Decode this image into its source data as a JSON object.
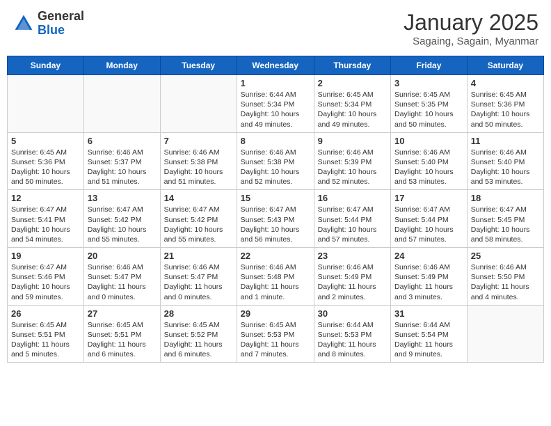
{
  "header": {
    "logo_general": "General",
    "logo_blue": "Blue",
    "month_title": "January 2025",
    "subtitle": "Sagaing, Sagain, Myanmar"
  },
  "days_of_week": [
    "Sunday",
    "Monday",
    "Tuesday",
    "Wednesday",
    "Thursday",
    "Friday",
    "Saturday"
  ],
  "weeks": [
    [
      {
        "num": "",
        "info": ""
      },
      {
        "num": "",
        "info": ""
      },
      {
        "num": "",
        "info": ""
      },
      {
        "num": "1",
        "info": "Sunrise: 6:44 AM\nSunset: 5:34 PM\nDaylight: 10 hours\nand 49 minutes."
      },
      {
        "num": "2",
        "info": "Sunrise: 6:45 AM\nSunset: 5:34 PM\nDaylight: 10 hours\nand 49 minutes."
      },
      {
        "num": "3",
        "info": "Sunrise: 6:45 AM\nSunset: 5:35 PM\nDaylight: 10 hours\nand 50 minutes."
      },
      {
        "num": "4",
        "info": "Sunrise: 6:45 AM\nSunset: 5:36 PM\nDaylight: 10 hours\nand 50 minutes."
      }
    ],
    [
      {
        "num": "5",
        "info": "Sunrise: 6:45 AM\nSunset: 5:36 PM\nDaylight: 10 hours\nand 50 minutes."
      },
      {
        "num": "6",
        "info": "Sunrise: 6:46 AM\nSunset: 5:37 PM\nDaylight: 10 hours\nand 51 minutes."
      },
      {
        "num": "7",
        "info": "Sunrise: 6:46 AM\nSunset: 5:38 PM\nDaylight: 10 hours\nand 51 minutes."
      },
      {
        "num": "8",
        "info": "Sunrise: 6:46 AM\nSunset: 5:38 PM\nDaylight: 10 hours\nand 52 minutes."
      },
      {
        "num": "9",
        "info": "Sunrise: 6:46 AM\nSunset: 5:39 PM\nDaylight: 10 hours\nand 52 minutes."
      },
      {
        "num": "10",
        "info": "Sunrise: 6:46 AM\nSunset: 5:40 PM\nDaylight: 10 hours\nand 53 minutes."
      },
      {
        "num": "11",
        "info": "Sunrise: 6:46 AM\nSunset: 5:40 PM\nDaylight: 10 hours\nand 53 minutes."
      }
    ],
    [
      {
        "num": "12",
        "info": "Sunrise: 6:47 AM\nSunset: 5:41 PM\nDaylight: 10 hours\nand 54 minutes."
      },
      {
        "num": "13",
        "info": "Sunrise: 6:47 AM\nSunset: 5:42 PM\nDaylight: 10 hours\nand 55 minutes."
      },
      {
        "num": "14",
        "info": "Sunrise: 6:47 AM\nSunset: 5:42 PM\nDaylight: 10 hours\nand 55 minutes."
      },
      {
        "num": "15",
        "info": "Sunrise: 6:47 AM\nSunset: 5:43 PM\nDaylight: 10 hours\nand 56 minutes."
      },
      {
        "num": "16",
        "info": "Sunrise: 6:47 AM\nSunset: 5:44 PM\nDaylight: 10 hours\nand 57 minutes."
      },
      {
        "num": "17",
        "info": "Sunrise: 6:47 AM\nSunset: 5:44 PM\nDaylight: 10 hours\nand 57 minutes."
      },
      {
        "num": "18",
        "info": "Sunrise: 6:47 AM\nSunset: 5:45 PM\nDaylight: 10 hours\nand 58 minutes."
      }
    ],
    [
      {
        "num": "19",
        "info": "Sunrise: 6:47 AM\nSunset: 5:46 PM\nDaylight: 10 hours\nand 59 minutes."
      },
      {
        "num": "20",
        "info": "Sunrise: 6:46 AM\nSunset: 5:47 PM\nDaylight: 11 hours\nand 0 minutes."
      },
      {
        "num": "21",
        "info": "Sunrise: 6:46 AM\nSunset: 5:47 PM\nDaylight: 11 hours\nand 0 minutes."
      },
      {
        "num": "22",
        "info": "Sunrise: 6:46 AM\nSunset: 5:48 PM\nDaylight: 11 hours\nand 1 minute."
      },
      {
        "num": "23",
        "info": "Sunrise: 6:46 AM\nSunset: 5:49 PM\nDaylight: 11 hours\nand 2 minutes."
      },
      {
        "num": "24",
        "info": "Sunrise: 6:46 AM\nSunset: 5:49 PM\nDaylight: 11 hours\nand 3 minutes."
      },
      {
        "num": "25",
        "info": "Sunrise: 6:46 AM\nSunset: 5:50 PM\nDaylight: 11 hours\nand 4 minutes."
      }
    ],
    [
      {
        "num": "26",
        "info": "Sunrise: 6:45 AM\nSunset: 5:51 PM\nDaylight: 11 hours\nand 5 minutes."
      },
      {
        "num": "27",
        "info": "Sunrise: 6:45 AM\nSunset: 5:51 PM\nDaylight: 11 hours\nand 6 minutes."
      },
      {
        "num": "28",
        "info": "Sunrise: 6:45 AM\nSunset: 5:52 PM\nDaylight: 11 hours\nand 6 minutes."
      },
      {
        "num": "29",
        "info": "Sunrise: 6:45 AM\nSunset: 5:53 PM\nDaylight: 11 hours\nand 7 minutes."
      },
      {
        "num": "30",
        "info": "Sunrise: 6:44 AM\nSunset: 5:53 PM\nDaylight: 11 hours\nand 8 minutes."
      },
      {
        "num": "31",
        "info": "Sunrise: 6:44 AM\nSunset: 5:54 PM\nDaylight: 11 hours\nand 9 minutes."
      },
      {
        "num": "",
        "info": ""
      }
    ]
  ]
}
